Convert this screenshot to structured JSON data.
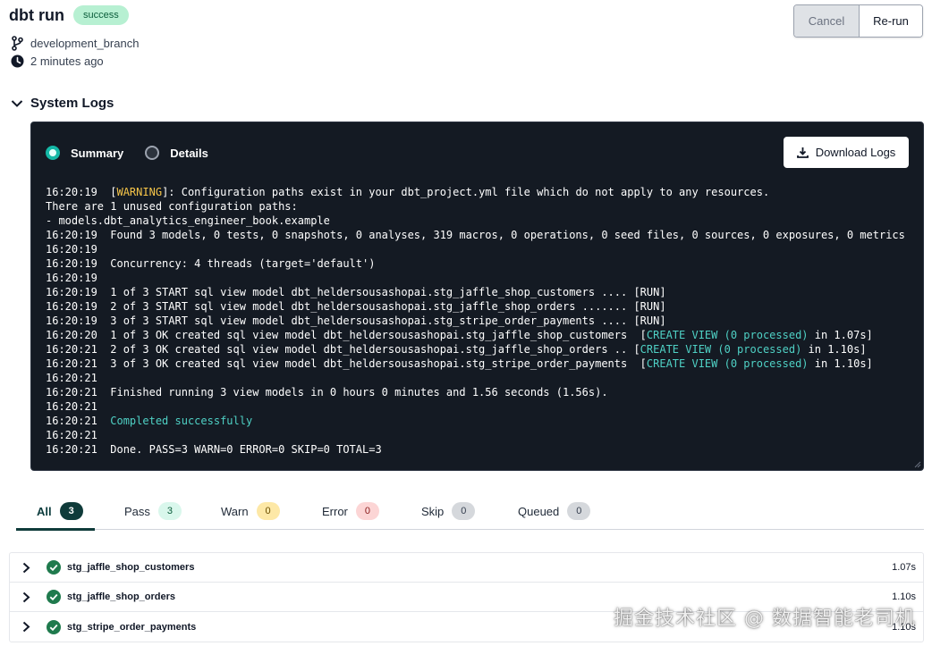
{
  "header": {
    "title": "dbt run",
    "status": "success",
    "branch": "development_branch",
    "time": "2 minutes ago",
    "cancel_label": "Cancel",
    "rerun_label": "Re-run"
  },
  "system_logs": {
    "title": "System Logs",
    "view_summary_label": "Summary",
    "view_details_label": "Details",
    "selected_view": "Summary",
    "download_label": "Download Logs",
    "lines": [
      {
        "ts": "16:20:19",
        "parts": [
          {
            "t": "[",
            "c": ""
          },
          {
            "t": "WARNING",
            "c": "warn"
          },
          {
            "t": "]: Configuration paths exist in your dbt_project.yml file which do not apply to any resources.",
            "c": ""
          }
        ]
      },
      {
        "ts": "",
        "parts": [
          {
            "t": "There are 1 unused configuration paths:",
            "c": ""
          }
        ]
      },
      {
        "ts": "",
        "parts": [
          {
            "t": "- models.dbt_analytics_engineer_book.example",
            "c": ""
          }
        ]
      },
      {
        "ts": "16:20:19",
        "parts": [
          {
            "t": "Found 3 models, 0 tests, 0 snapshots, 0 analyses, 319 macros, 0 operations, 0 seed files, 0 sources, 0 exposures, 0 metrics",
            "c": ""
          }
        ]
      },
      {
        "ts": "16:20:19",
        "parts": []
      },
      {
        "ts": "16:20:19",
        "parts": [
          {
            "t": "Concurrency: 4 threads (target='default')",
            "c": ""
          }
        ]
      },
      {
        "ts": "16:20:19",
        "parts": []
      },
      {
        "ts": "16:20:19",
        "parts": [
          {
            "t": "1 of 3 START sql view model dbt_heldersousashopai.stg_jaffle_shop_customers .... [RUN]",
            "c": ""
          }
        ]
      },
      {
        "ts": "16:20:19",
        "parts": [
          {
            "t": "2 of 3 START sql view model dbt_heldersousashopai.stg_jaffle_shop_orders ....... [RUN]",
            "c": ""
          }
        ]
      },
      {
        "ts": "16:20:19",
        "parts": [
          {
            "t": "3 of 3 START sql view model dbt_heldersousashopai.stg_stripe_order_payments .... [RUN]",
            "c": ""
          }
        ]
      },
      {
        "ts": "16:20:20",
        "parts": [
          {
            "t": "1 of 3 OK created sql view model dbt_heldersousashopai.stg_jaffle_shop_customers  [",
            "c": ""
          },
          {
            "t": "CREATE VIEW (0 processed)",
            "c": "teal"
          },
          {
            "t": " in 1.07s]",
            "c": ""
          }
        ]
      },
      {
        "ts": "16:20:21",
        "parts": [
          {
            "t": "2 of 3 OK created sql view model dbt_heldersousashopai.stg_jaffle_shop_orders .. [",
            "c": ""
          },
          {
            "t": "CREATE VIEW (0 processed)",
            "c": "teal"
          },
          {
            "t": " in 1.10s]",
            "c": ""
          }
        ]
      },
      {
        "ts": "16:20:21",
        "parts": [
          {
            "t": "3 of 3 OK created sql view model dbt_heldersousashopai.stg_stripe_order_payments  [",
            "c": ""
          },
          {
            "t": "CREATE VIEW (0 processed)",
            "c": "teal"
          },
          {
            "t": " in 1.10s]",
            "c": ""
          }
        ]
      },
      {
        "ts": "16:20:21",
        "parts": []
      },
      {
        "ts": "16:20:21",
        "parts": [
          {
            "t": "Finished running 3 view models in 0 hours 0 minutes and 1.56 seconds (1.56s).",
            "c": ""
          }
        ]
      },
      {
        "ts": "16:20:21",
        "parts": []
      },
      {
        "ts": "16:20:21",
        "parts": [
          {
            "t": "Completed successfully",
            "c": "teal"
          }
        ]
      },
      {
        "ts": "16:20:21",
        "parts": []
      },
      {
        "ts": "16:20:21",
        "parts": [
          {
            "t": "Done. PASS=3 WARN=0 ERROR=0 SKIP=0 TOTAL=3",
            "c": ""
          }
        ]
      }
    ]
  },
  "tabs": [
    {
      "label": "All",
      "count": "3",
      "bg": "#0f3b3a",
      "fg": "#ffffff",
      "active": true
    },
    {
      "label": "Pass",
      "count": "3",
      "bg": "#d9f7ec",
      "fg": "#0b5d3b",
      "active": false
    },
    {
      "label": "Warn",
      "count": "0",
      "bg": "#fde8a6",
      "fg": "#6b4e00",
      "active": false
    },
    {
      "label": "Error",
      "count": "0",
      "bg": "#fcd5d5",
      "fg": "#8a1c1c",
      "active": false
    },
    {
      "label": "Skip",
      "count": "0",
      "bg": "#d5d8dc",
      "fg": "#374151",
      "active": false
    },
    {
      "label": "Queued",
      "count": "0",
      "bg": "#d5d8dc",
      "fg": "#374151",
      "active": false
    }
  ],
  "models": [
    {
      "name": "stg_jaffle_shop_customers",
      "duration": "1.07s",
      "icon": "check-circle-icon"
    },
    {
      "name": "stg_jaffle_shop_orders",
      "duration": "1.10s",
      "icon": "check-circle-icon"
    },
    {
      "name": "stg_stripe_order_payments",
      "duration": "1.10s",
      "icon": "check-circle-icon"
    }
  ],
  "watermark": "掘金技术社区 @ 数据智能老司机",
  "colors": {
    "accent": "#14b8a6",
    "success_badge": "#b7f0d2",
    "console_bg": "#141a23",
    "warning_text": "#f6c549",
    "success_text": "#4fd1c5"
  }
}
